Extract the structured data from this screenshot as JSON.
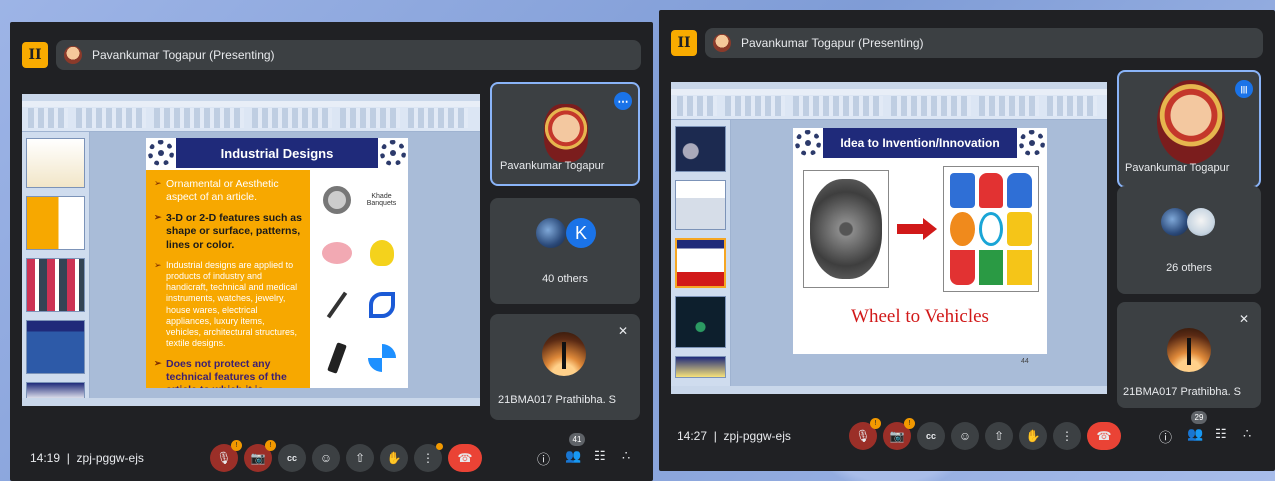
{
  "left": {
    "presenter_label": "Pavankumar Togapur (Presenting)",
    "slide": {
      "title": "Industrial Designs",
      "bullets": [
        "Ornamental or Aesthetic aspect of an article.",
        "3-D or 2-D features such as shape or surface, patterns, lines or color.",
        "Industrial designs are applied to products of industry and handicraft, technical and medical instruments, watches, jewelry, house wares, electrical appliances, luxury items, vehicles, architectural structures, textile designs.",
        "Does not protect any technical features of the article to which it is applied to."
      ],
      "image_caption": "Khade Banquets"
    },
    "participants": [
      {
        "name": "Pavankumar Togapur"
      },
      {
        "name": "40 others",
        "initial": "K"
      },
      {
        "name": "21BMA017 Prathibha. S"
      }
    ],
    "time": "14:19",
    "meeting_code": "zpj-pggw-ejs",
    "people_count": "41"
  },
  "right": {
    "presenter_label": "Pavankumar Togapur (Presenting)",
    "slide": {
      "title": "Idea to Invention/Innovation",
      "footer": "Wheel to Vehicles",
      "page_number": "44"
    },
    "participants": [
      {
        "name": "Pavankumar Togapur"
      },
      {
        "name": "26 others"
      },
      {
        "name": "21BMA017 Prathibha. S"
      }
    ],
    "time": "14:27",
    "meeting_code": "zpj-pggw-ejs",
    "people_count": "29"
  },
  "icons": {
    "mic_off": "🎙",
    "cam_off": "📷",
    "cc": "cc",
    "emoji": "☺",
    "present": "⇧",
    "hand": "✋",
    "more": "⋮",
    "hangup": "☎",
    "info": "ⓘ",
    "people": "👥",
    "chat": "☷",
    "activities": "∴",
    "mute_small": "✕"
  },
  "colors": {
    "meet_bg": "#202124",
    "tile_bg": "#3c4043",
    "accent_blue": "#1a73e8",
    "end_red": "#ea4335",
    "slide_orange": "#f7a800",
    "slide_navy": "#1f2a7a",
    "vehicles_red": "#d11919"
  }
}
